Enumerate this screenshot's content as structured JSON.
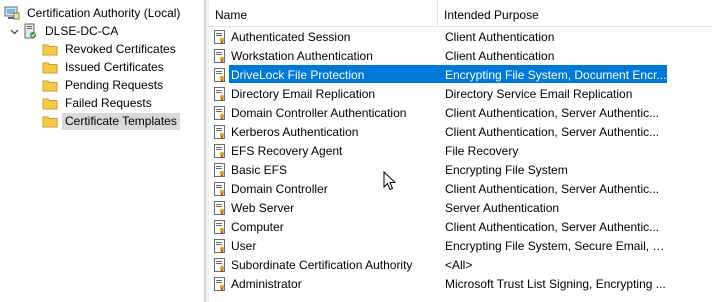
{
  "tree": {
    "root_label": "Certification Authority (Local)",
    "ca_label": "DLSE-DC-CA",
    "folders": [
      {
        "label": "Revoked Certificates",
        "selected": false
      },
      {
        "label": "Issued Certificates",
        "selected": false
      },
      {
        "label": "Pending Requests",
        "selected": false
      },
      {
        "label": "Failed Requests",
        "selected": false
      },
      {
        "label": "Certificate Templates",
        "selected": true
      }
    ]
  },
  "list": {
    "columns": {
      "name": "Name",
      "purpose": "Intended Purpose"
    },
    "rows": [
      {
        "name": "Authenticated Session",
        "purpose": "Client Authentication"
      },
      {
        "name": "Workstation Authentication",
        "purpose": "Client Authentication"
      },
      {
        "name": "DriveLock File Protection",
        "purpose": "Encrypting File System, Document Encr..."
      },
      {
        "name": "Directory Email Replication",
        "purpose": "Directory Service Email Replication"
      },
      {
        "name": "Domain Controller Authentication",
        "purpose": "Client Authentication, Server Authentic..."
      },
      {
        "name": "Kerberos Authentication",
        "purpose": "Client Authentication, Server Authentic..."
      },
      {
        "name": "EFS Recovery Agent",
        "purpose": "File Recovery"
      },
      {
        "name": "Basic EFS",
        "purpose": "Encrypting File System"
      },
      {
        "name": "Domain Controller",
        "purpose": "Client Authentication, Server Authentic..."
      },
      {
        "name": "Web Server",
        "purpose": "Server Authentication"
      },
      {
        "name": "Computer",
        "purpose": "Client Authentication, Server Authentic..."
      },
      {
        "name": "User",
        "purpose": "Encrypting File System, Secure Email, Cl..."
      },
      {
        "name": "Subordinate Certification Authority",
        "purpose": "<All>"
      },
      {
        "name": "Administrator",
        "purpose": "Microsoft Trust List Signing, Encrypting ..."
      }
    ],
    "selected_index": 2
  },
  "colors": {
    "selection": "#0078d7",
    "folder": "#f5c94a",
    "tree_selected": "#d9d9d9"
  },
  "icons": {
    "root": "ca-computer-icon",
    "ca": "ca-server-icon",
    "folder": "folder-icon",
    "template": "certificate-template-icon",
    "cursor": "mouse-pointer-icon"
  }
}
